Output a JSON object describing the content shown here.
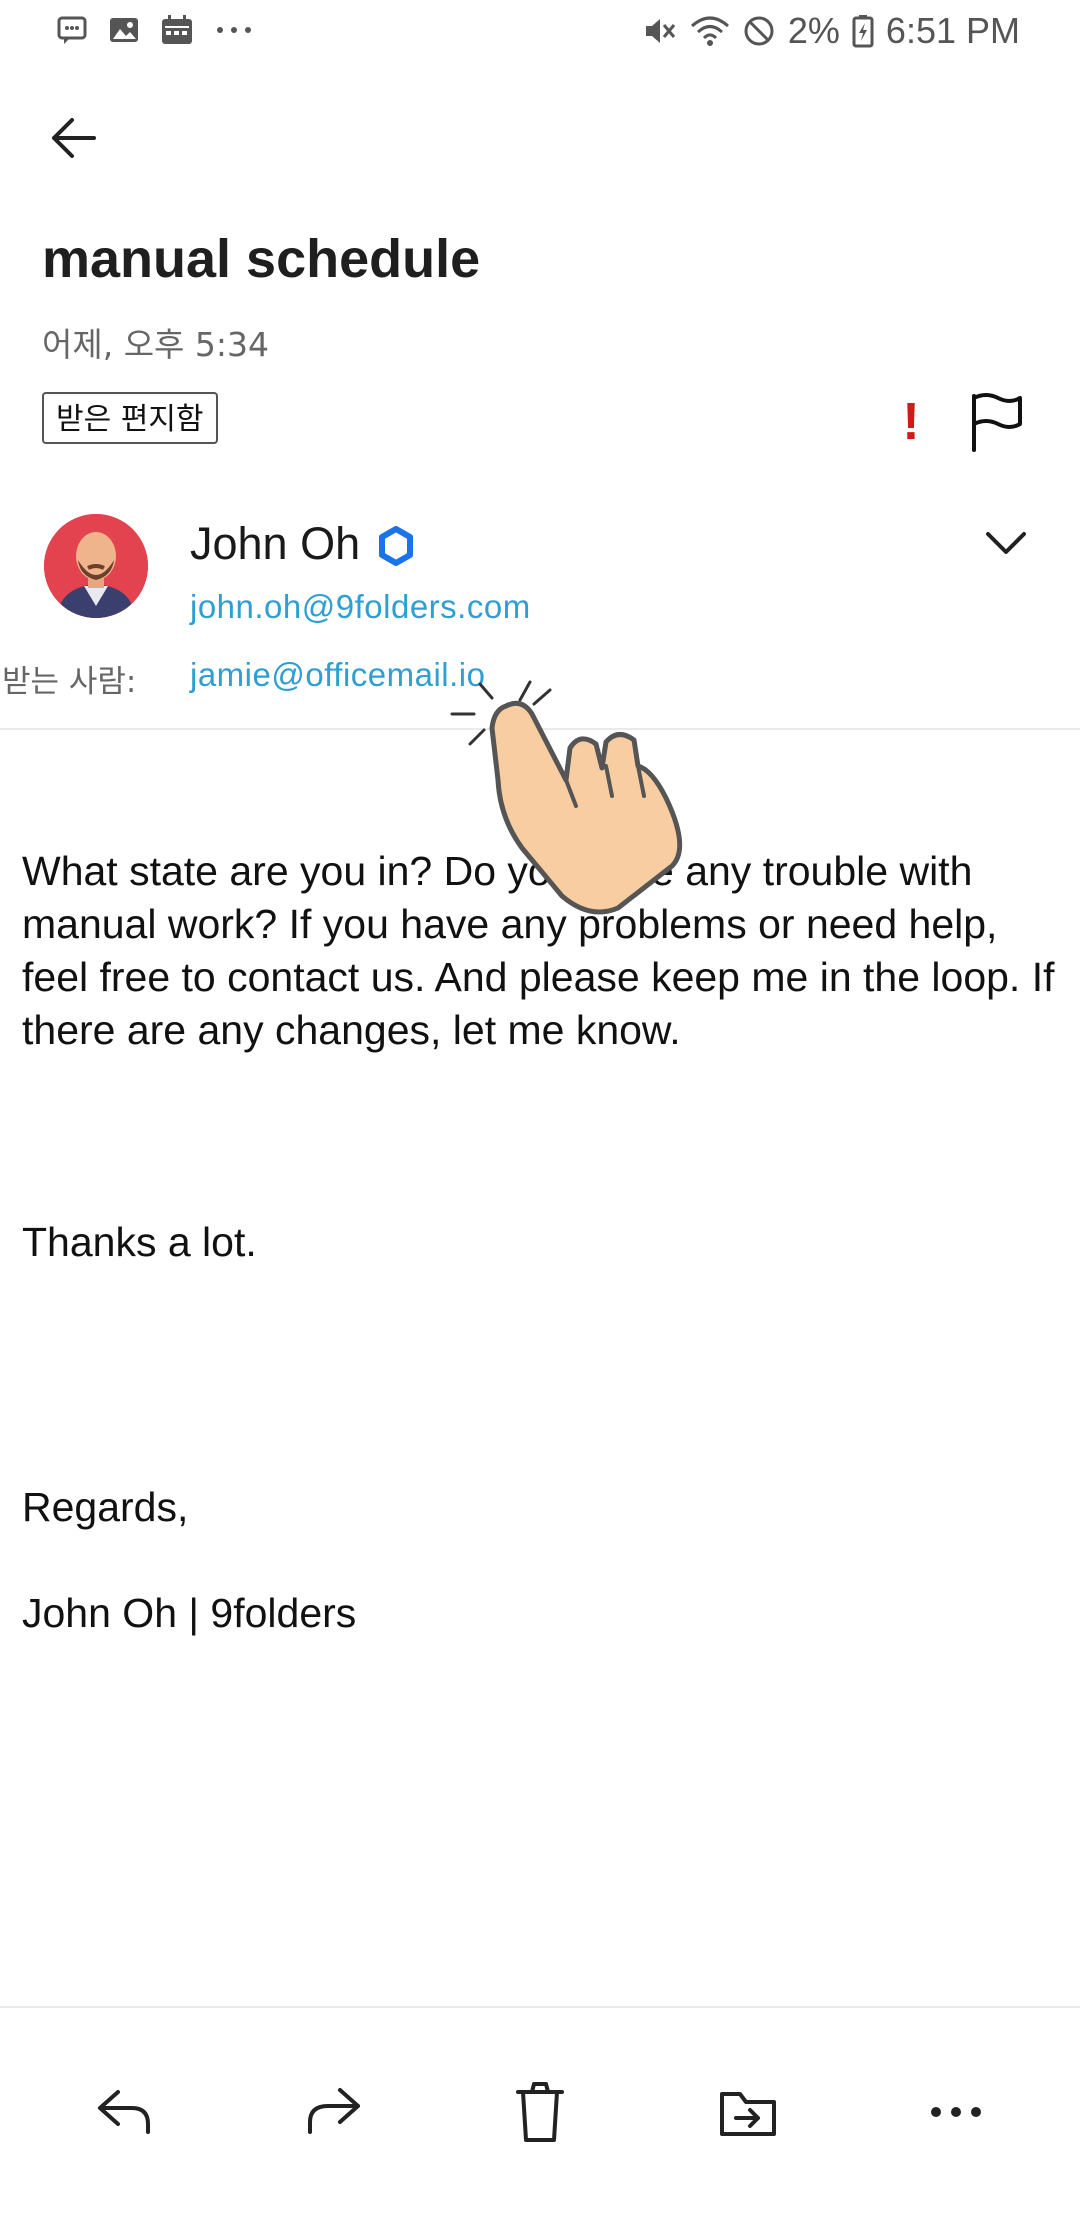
{
  "status_bar": {
    "battery": "2%",
    "time": "6:51 PM",
    "left_icons": [
      "message-icon",
      "gallery-icon",
      "calendar-icon",
      "more-dots-icon"
    ],
    "right_icons": [
      "mute-icon",
      "wifi-icon",
      "no-disturb-icon",
      "battery-icon"
    ]
  },
  "email": {
    "subject": "manual schedule",
    "date": "어제, 오후 5:34",
    "folder": "받은 편지함",
    "importance_mark": "!",
    "sender": {
      "name": "John Oh",
      "email": "john.oh@9folders.com"
    },
    "to_label": "받는 사람:",
    "to_email": "jamie@officemail.io",
    "body": {
      "paragraph1": "What state are you in? Do you have any trouble with manual work? If you have any problems or need help, feel free to contact us. And please keep me in the loop. If there are any changes, let me know.",
      "paragraph2": "Thanks a lot.",
      "signoff": "Regards,",
      "signature": "John Oh | 9folders"
    }
  },
  "toolbar": {
    "icons": [
      "reply-icon",
      "forward-icon",
      "delete-icon",
      "move-folder-icon",
      "more-icon"
    ]
  },
  "colors": {
    "link": "#2f9fd3",
    "importance": "#d01a1a",
    "verified": "#1a73e8",
    "avatar_bg": "#e2434f"
  }
}
